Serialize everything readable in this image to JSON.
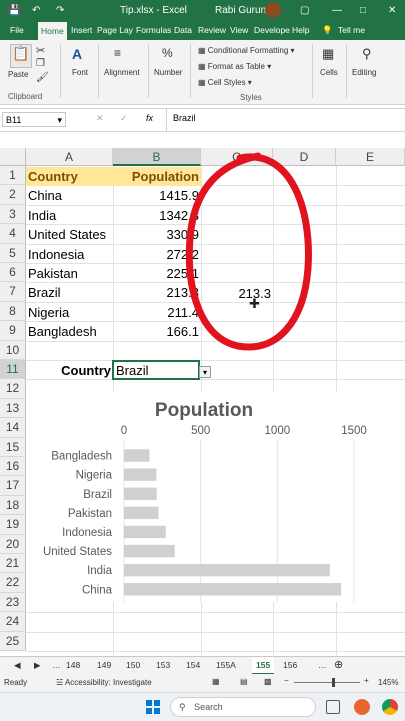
{
  "window": {
    "title": "Tip.xlsx - Excel",
    "user": "Rabi Gurung"
  },
  "ribbon_tabs": [
    "File",
    "Home",
    "Insert",
    "Page Lay",
    "Formulas",
    "Data",
    "Review",
    "View",
    "Develope",
    "Help",
    "Tell me"
  ],
  "ribbon": {
    "paste": "Paste",
    "font": "Font",
    "alignment": "Alignment",
    "number": "Number",
    "conditional": "Conditional Formatting",
    "format_table": "Format as Table",
    "cell_styles": "Cell Styles",
    "cells": "Cells",
    "editing": "Editing",
    "clipboard_group": "Clipboard",
    "styles_group": "Styles"
  },
  "formula_bar": {
    "name_box": "B11",
    "fx": "fx",
    "value": "Brazil"
  },
  "columns": [
    "A",
    "B",
    "C",
    "D",
    "E"
  ],
  "rows": [
    "1",
    "2",
    "3",
    "4",
    "5",
    "6",
    "7",
    "8",
    "9",
    "10",
    "11",
    "12",
    "13",
    "14",
    "15",
    "16",
    "17",
    "18",
    "19",
    "20",
    "21",
    "22",
    "23",
    "24",
    "25"
  ],
  "table": {
    "header_country": "Country",
    "header_population": "Population",
    "data": [
      {
        "country": "China",
        "population": "1415.9"
      },
      {
        "country": "India",
        "population": "1342.3"
      },
      {
        "country": "United States",
        "population": "330.9"
      },
      {
        "country": "Indonesia",
        "population": "272.2"
      },
      {
        "country": "Pakistan",
        "population": "225.1"
      },
      {
        "country": "Brazil",
        "population": "213.3"
      },
      {
        "country": "Nigeria",
        "population": "211.4"
      },
      {
        "country": "Bangladesh",
        "population": "166.1"
      }
    ],
    "lookup_value": "213.3",
    "label_country": "Country",
    "selected_country": "Brazil"
  },
  "chart_data": {
    "type": "bar",
    "title": "Population",
    "categories": [
      "Bangladesh",
      "Nigeria",
      "Brazil",
      "Pakistan",
      "Indonesia",
      "United States",
      "India",
      "China"
    ],
    "values": [
      166.1,
      211.4,
      213.3,
      225.1,
      272.2,
      330.9,
      1342.3,
      1415.9
    ],
    "x_ticks": [
      "0",
      "500",
      "1000",
      "1500"
    ],
    "xlim": [
      0,
      1500
    ],
    "bar_color": "#d0d0d0",
    "xlabel": "",
    "ylabel": "",
    "grid": true
  },
  "sheet_tabs": [
    "148",
    "149",
    "150",
    "153",
    "154",
    "155A",
    "155",
    "156"
  ],
  "active_sheet": "155",
  "status": {
    "ready": "Ready",
    "accessibility": "Accessibility: Investigate",
    "zoom": "145%"
  },
  "taskbar": {
    "search": "Search"
  },
  "colors": {
    "excel_green": "#217346",
    "header_fill": "#ffe699",
    "annotation_red": "#e0131f"
  }
}
